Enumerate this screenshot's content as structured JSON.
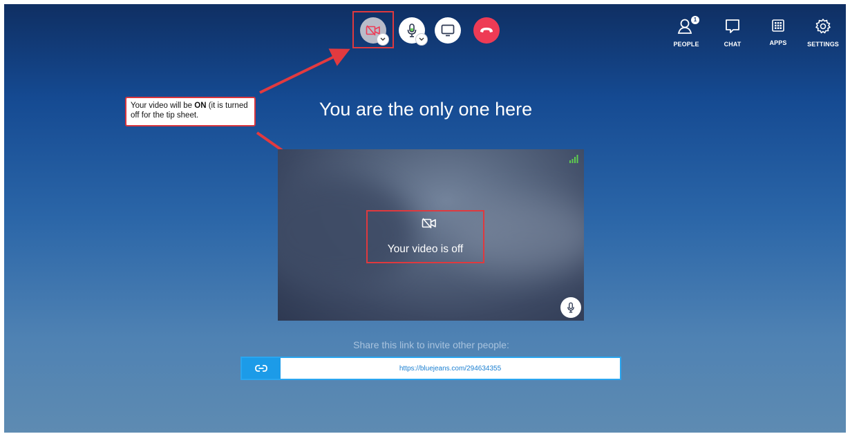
{
  "toolbar": {
    "video_button": "video-off-icon",
    "mic_button": "microphone-icon",
    "share_button": "screen-share-icon",
    "hangup_button": "hang-up-icon"
  },
  "nav": {
    "people": {
      "label": "PEOPLE",
      "badge": "1"
    },
    "chat": {
      "label": "CHAT"
    },
    "apps": {
      "label": "APPS"
    },
    "settings": {
      "label": "SETTINGS"
    }
  },
  "callout": {
    "text_before": "Your video will be ",
    "text_bold": "ON",
    "text_after": " (it is turned off for the tip sheet."
  },
  "main": {
    "heading": "You are the only one here",
    "video_status": "Your video is off",
    "share_label": "Share this link to invite other people:",
    "share_link": "https://bluejeans.com/294634355"
  },
  "colors": {
    "accent": "#1c9be8",
    "hangup": "#ee3b55",
    "annotation": "#e0393e",
    "signal": "#5fcf4e"
  }
}
